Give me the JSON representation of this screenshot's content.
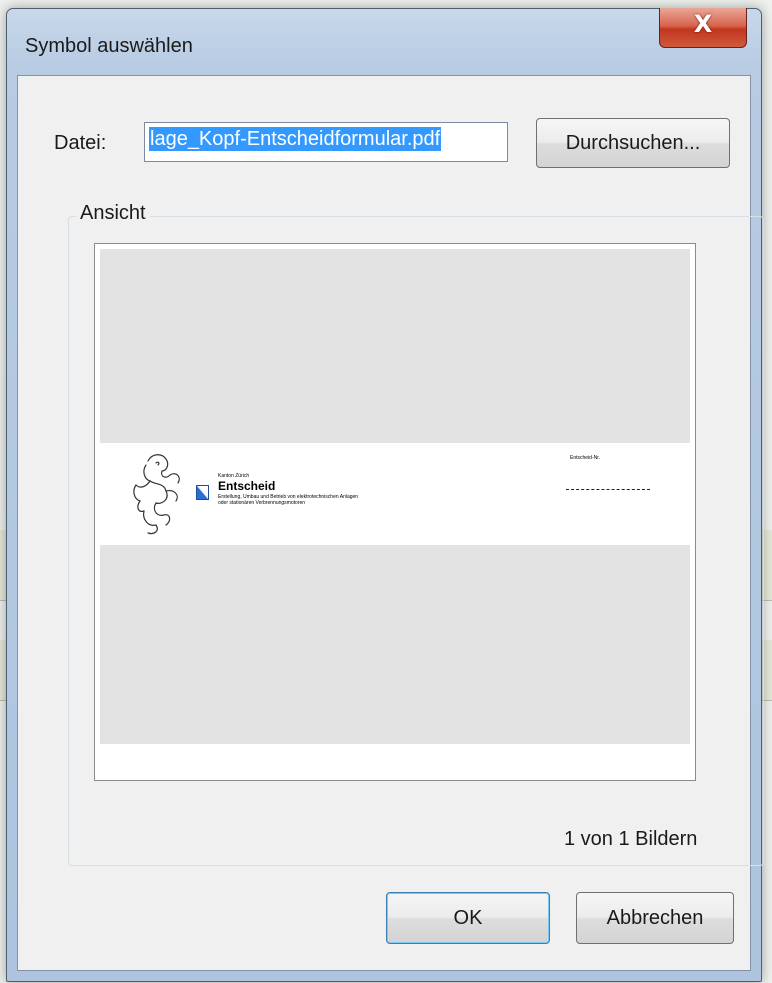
{
  "dialog": {
    "title": "Symbol auswählen",
    "close_glyph": "X"
  },
  "file": {
    "label": "Datei:",
    "value": "lage_Kopf-Entscheidformular.pdf",
    "browse_label": "Durchsuchen..."
  },
  "preview": {
    "group_label": "Ansicht",
    "document": {
      "canton": "Kanton Zürich",
      "heading": "Entscheid",
      "subtitle_line1": "Erstellung, Umbau und Betrieb von elektrotechnischen Anlagen",
      "subtitle_line2": "oder stationären Verbrennungsmotoren",
      "number_label": "Entscheid-Nr."
    },
    "counter": "1 von 1 Bildern"
  },
  "buttons": {
    "ok_label": "OK",
    "cancel_label": "Abbrechen"
  },
  "colors": {
    "selection": "#3399ff",
    "close_button": "#c2361e",
    "frame": "#b7cbe3"
  },
  "icons": [
    "close-icon",
    "zurich-lion-logo",
    "zurich-canton-mark"
  ]
}
